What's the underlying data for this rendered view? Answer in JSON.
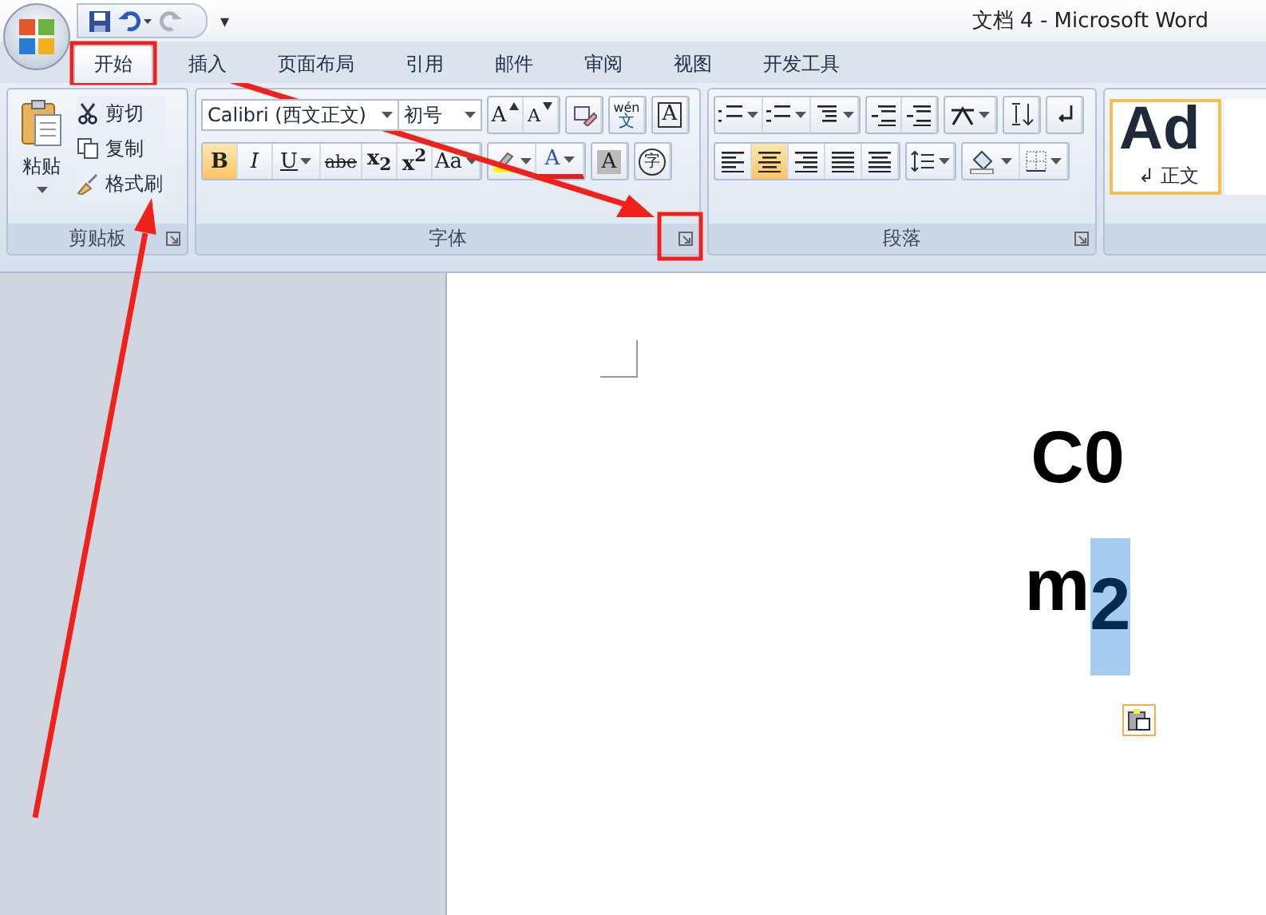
{
  "window": {
    "title": "文档 4 - Microsoft Word",
    "menu_glyph": "▾"
  },
  "tabs": [
    {
      "label": "开始",
      "selected": true
    },
    {
      "label": "插入",
      "selected": false
    },
    {
      "label": "页面布局",
      "selected": false
    },
    {
      "label": "引用",
      "selected": false
    },
    {
      "label": "邮件",
      "selected": false
    },
    {
      "label": "审阅",
      "selected": false
    },
    {
      "label": "视图",
      "selected": false
    },
    {
      "label": "开发工具",
      "selected": false
    }
  ],
  "clipboard": {
    "label": "剪贴板",
    "paste": "粘贴",
    "items": [
      {
        "kind": "cut",
        "label": "剪切"
      },
      {
        "kind": "copy",
        "label": "复制"
      },
      {
        "kind": "painter",
        "label": "格式刷"
      }
    ]
  },
  "font": {
    "label": "字体",
    "font_name": "Calibri (西文正文)",
    "font_size": "初号",
    "row_1": [
      {
        "kind": "grow",
        "label": "A"
      },
      {
        "kind": "shrink",
        "label": "A"
      },
      {
        "kind": "clear"
      },
      {
        "kind": "phonetic",
        "label": "文",
        "ruby": "wén"
      },
      {
        "kind": "border",
        "label": "A"
      }
    ],
    "row_2": [
      {
        "kind": "bold",
        "label": "B",
        "selected": true
      },
      {
        "kind": "italic",
        "label": "I",
        "selected": false
      },
      {
        "kind": "underline",
        "label": "U",
        "selected": false
      },
      {
        "kind": "strike",
        "label": "abe",
        "selected": false
      },
      {
        "kind": "subscript",
        "label": "x$_{2}$",
        "selected": false
      },
      {
        "kind": "superscript",
        "label": "x$^{2}$",
        "selected": false
      },
      {
        "kind": "case",
        "label": "Aa"
      },
      {
        "kind": "highlight"
      },
      {
        "kind": "color",
        "label": "A"
      },
      {
        "kind": "shading",
        "label": "A"
      },
      {
        "kind": "enclose",
        "label": "字"
      }
    ]
  },
  "paragraph": {
    "label": "段落",
    "alignment": [
      {
        "kind": "left",
        "selected": false
      },
      {
        "kind": "center",
        "selected": true
      },
      {
        "kind": "right",
        "selected": false
      },
      {
        "kind": "justify",
        "selected": false
      },
      {
        "kind": "distributed",
        "selected": false
      }
    ]
  },
  "styles": [
    {
      "preview": "Ad",
      "label": "正文",
      "mark": "↲",
      "selected": true
    }
  ],
  "document": {
    "lines": [
      {
        "segments": [
          {
            "text": "C0",
            "selected": false
          }
        ]
      },
      {
        "segments": [
          {
            "text": "m",
            "selected": false
          },
          {
            "text": "2",
            "selected": true
          }
        ]
      }
    ]
  }
}
